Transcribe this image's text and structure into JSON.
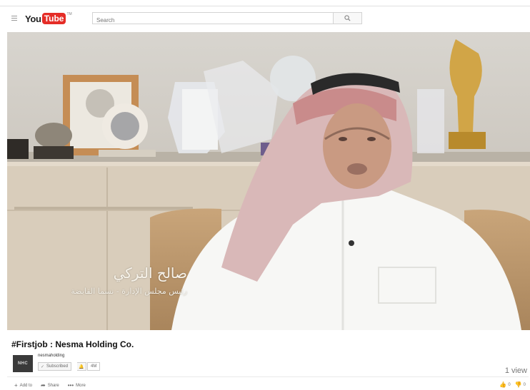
{
  "header": {
    "logo_you": "You",
    "logo_tube": "Tube",
    "logo_tm": "TM",
    "search_placeholder": "Search"
  },
  "video": {
    "caption_name": "صالح التركي",
    "caption_title": "رئيس مجلس الإدارة - نسما القابضة"
  },
  "info": {
    "title": "#Firstjob : Nesma Holding Co.",
    "channel_name": "nesmaholding",
    "avatar_text": "NHC",
    "subscribed_label": "Subscribed",
    "subscriber_count": "4M",
    "views": "1 view"
  },
  "actions": {
    "add_to": "Add to",
    "share": "Share",
    "more": "More",
    "likes": "0",
    "dislikes": "0"
  },
  "colors": {
    "brand_red": "#e52d27",
    "background": "#ffffff"
  }
}
